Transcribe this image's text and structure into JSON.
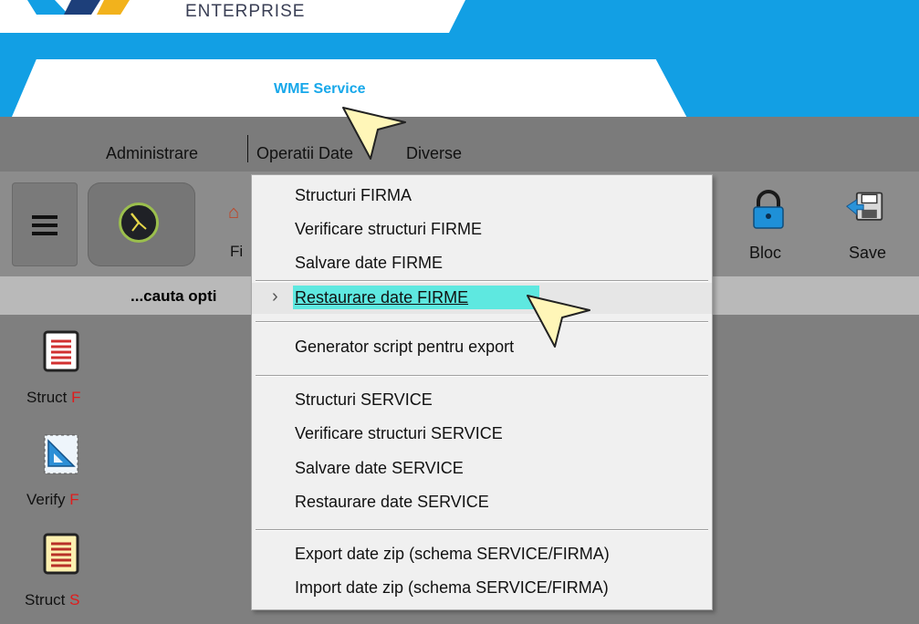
{
  "header": {
    "brand": "ENTERPRISE",
    "tab_title": "WME Service"
  },
  "menubar": {
    "items": [
      "Administrare",
      "Operatii Date",
      "Diverse"
    ]
  },
  "toolbar": {
    "fi_label": "Fi",
    "bloc_label": "Bloc",
    "save_label": "Save"
  },
  "search": {
    "label": "...cauta opti"
  },
  "sidebar": {
    "items": [
      {
        "label": "Struct ",
        "suffix": "F"
      },
      {
        "label": "Verify ",
        "suffix": "F"
      },
      {
        "label": "Struct ",
        "suffix": "S"
      }
    ]
  },
  "menu": {
    "items": [
      "Structuri FIRMA",
      "Verificare structuri FIRME",
      "Salvare date FIRME",
      "Restaurare date FIRME",
      "Generator script pentru export",
      "Structuri SERVICE",
      "Verificare structuri SERVICE",
      "Salvare date SERVICE",
      "Restaurare date SERVICE",
      "Export date zip (schema SERVICE/FIRMA)",
      "Import date zip (schema SERVICE/FIRMA)"
    ],
    "highlighted_index": 3
  },
  "colors": {
    "accent_blue": "#129fe4",
    "highlight": "#5ee8e0",
    "marker_red": "#e21b1b"
  }
}
